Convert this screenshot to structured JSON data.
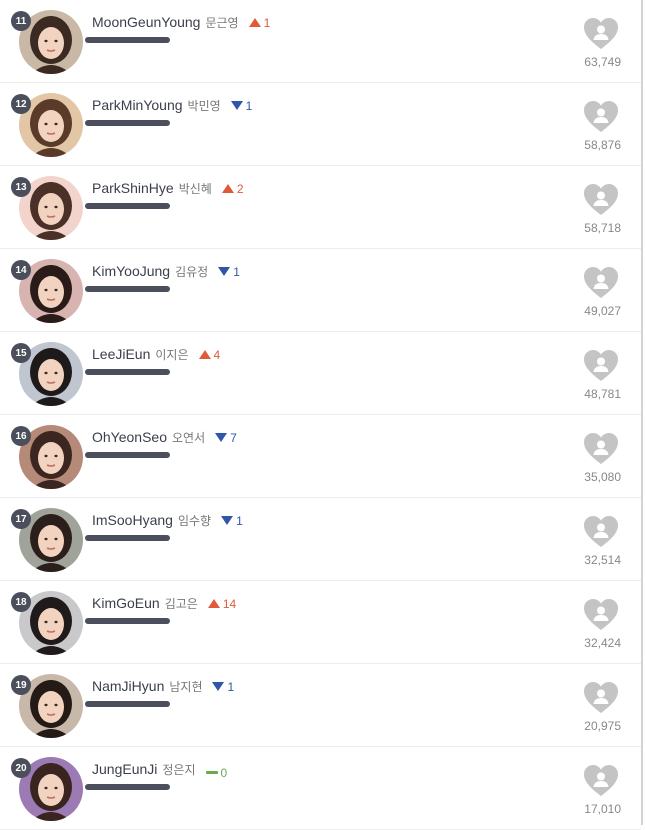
{
  "entries": [
    {
      "rank": "11",
      "name_en": "MoonGeunYoung",
      "name_ko": "문근영",
      "direction": "up",
      "change": "1",
      "votes": "63,749",
      "avatar_bg": "#c9b8a6",
      "hair": "#3a2a22"
    },
    {
      "rank": "12",
      "name_en": "ParkMinYoung",
      "name_ko": "박민영",
      "direction": "down",
      "change": "1",
      "votes": "58,876",
      "avatar_bg": "#e3c6a5",
      "hair": "#5a3a28"
    },
    {
      "rank": "13",
      "name_en": "ParkShinHye",
      "name_ko": "박신혜",
      "direction": "up",
      "change": "2",
      "votes": "58,718",
      "avatar_bg": "#f2d4cc",
      "hair": "#4a3026"
    },
    {
      "rank": "14",
      "name_en": "KimYooJung",
      "name_ko": "김유정",
      "direction": "down",
      "change": "1",
      "votes": "49,027",
      "avatar_bg": "#d7b4b0",
      "hair": "#2a1a18"
    },
    {
      "rank": "15",
      "name_en": "LeeJiEun",
      "name_ko": "이지은",
      "direction": "up",
      "change": "4",
      "votes": "48,781",
      "avatar_bg": "#bfc6cf",
      "hair": "#1e1a1a"
    },
    {
      "rank": "16",
      "name_en": "OhYeonSeo",
      "name_ko": "오연서",
      "direction": "down",
      "change": "7",
      "votes": "35,080",
      "avatar_bg": "#b58a78",
      "hair": "#3b2620"
    },
    {
      "rank": "17",
      "name_en": "ImSooHyang",
      "name_ko": "임수향",
      "direction": "down",
      "change": "1",
      "votes": "32,514",
      "avatar_bg": "#a0a39a",
      "hair": "#2b1f1b"
    },
    {
      "rank": "18",
      "name_en": "KimGoEun",
      "name_ko": "김고은",
      "direction": "up",
      "change": "14",
      "votes": "32,424",
      "avatar_bg": "#c9c9cc",
      "hair": "#201a1a"
    },
    {
      "rank": "19",
      "name_en": "NamJiHyun",
      "name_ko": "남지현",
      "direction": "down",
      "change": "1",
      "votes": "20,975",
      "avatar_bg": "#c7b8aa",
      "hair": "#241a16"
    },
    {
      "rank": "20",
      "name_en": "JungEunJi",
      "name_ko": "정은지",
      "direction": "same",
      "change": "0",
      "votes": "17,010",
      "avatar_bg": "#9c7ab4",
      "hair": "#3a2420"
    }
  ],
  "colors": {
    "up": "#e05a3a",
    "down": "#2f56a8",
    "same": "#6aa84f",
    "badge": "#4b4f5c",
    "heart": "#c4c4c4"
  },
  "icons": {
    "vote": "heart-user-icon",
    "up": "triangle-up-icon",
    "down": "triangle-down-icon",
    "same": "dash-icon"
  }
}
